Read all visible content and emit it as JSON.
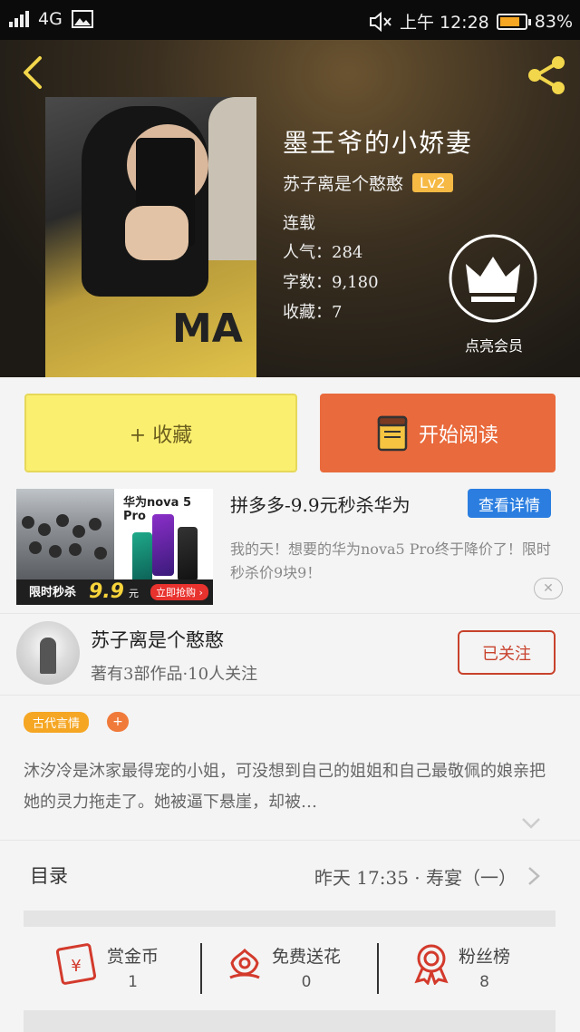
{
  "status_bar": {
    "network": "4G",
    "time_label": "上午 12:28",
    "battery": "83%",
    "battery_level": 0.83
  },
  "book": {
    "title": "墨王爷的小娇妻",
    "author": "苏子离是个憨憨",
    "level": "Lv2",
    "status": "连载",
    "popularity": "人气：284",
    "word_count": "字数：9,180",
    "favorites": "收藏：7",
    "vip_label": "点亮会员",
    "cover_text": "MA"
  },
  "actions": {
    "collect_label": "+ 收藏",
    "read_label": "开始阅读"
  },
  "ad": {
    "image_brand": "华为nova 5 Pro",
    "image_flash": "限时秒杀",
    "image_price": "9.9",
    "image_unit": "元",
    "image_buy": "立即抢购 ›",
    "title": "拼多多-9.9元秒杀华为",
    "detail_label": "查看详情",
    "description": "我的天！想要的华为nova5 Pro终于降价了！限时秒杀价9块9！",
    "close": "✕"
  },
  "author_block": {
    "name": "苏子离是个憨憨",
    "meta": "著有3部作品·10人关注",
    "follow_label": "已关注"
  },
  "tags": {
    "genre": "古代言情",
    "add": "+"
  },
  "synopsis": "沐汐冷是沐家最得宠的小姐，可没想到自己的姐姐和自己最敬佩的娘亲把她的灵力拖走了。她被逼下悬崖，却被…",
  "catalog": {
    "label": "目录",
    "latest": "昨天 17:35 · 寿宴（一）"
  },
  "stats": [
    {
      "label": "赏金币",
      "value": "1",
      "icon": "red-envelope-icon"
    },
    {
      "label": "免费送花",
      "value": "0",
      "icon": "flower-icon"
    },
    {
      "label": "粉丝榜",
      "value": "8",
      "icon": "medal-icon"
    }
  ],
  "colors": {
    "collect_bg": "#fbef6f",
    "read_bg": "#e96a3c",
    "accent_red": "#c8422c",
    "detail_blue": "#2b7ee0",
    "tag_orange": "#f5a623"
  }
}
